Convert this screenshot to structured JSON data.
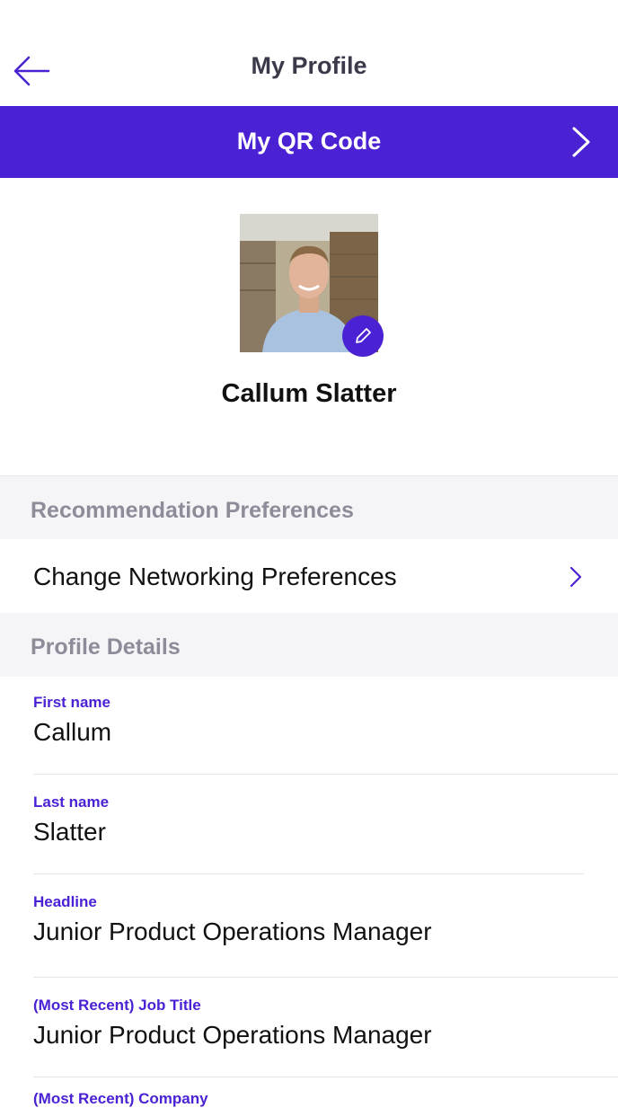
{
  "header": {
    "title": "My Profile"
  },
  "qr": {
    "label": "My QR Code"
  },
  "profile": {
    "name": "Callum Slatter"
  },
  "sections": {
    "recommendation": "Recommendation Preferences",
    "details": "Profile Details"
  },
  "networking": {
    "label": "Change Networking Preferences"
  },
  "fields": [
    {
      "label": "First name",
      "value": "Callum"
    },
    {
      "label": "Last name",
      "value": "Slatter"
    },
    {
      "label": "Headline",
      "value": "Junior Product Operations Manager"
    },
    {
      "label": "(Most Recent) Job Title",
      "value": "Junior Product Operations Manager"
    },
    {
      "label": "(Most Recent) Company",
      "value": ""
    }
  ],
  "colors": {
    "accent": "#4a22d4",
    "section_bg": "#f5f5f8",
    "section_text": "#8d8c99"
  },
  "icons": [
    "back-arrow-icon",
    "chevron-right-icon",
    "pencil-icon"
  ]
}
